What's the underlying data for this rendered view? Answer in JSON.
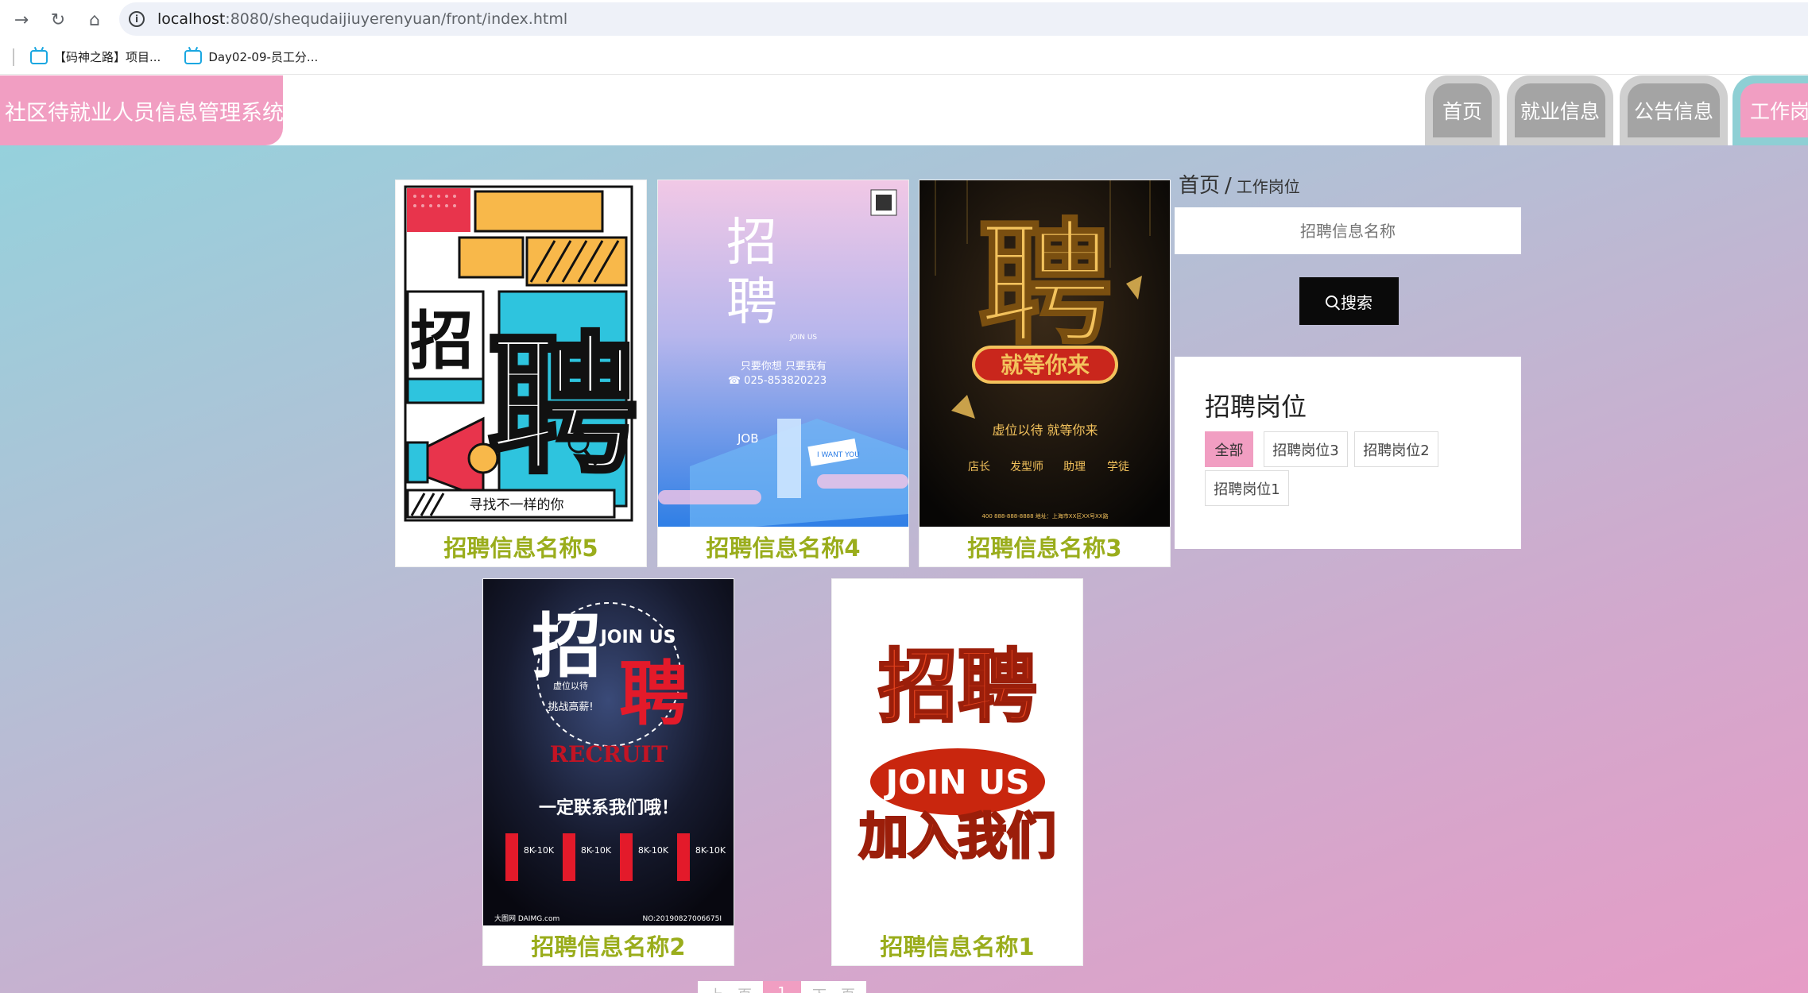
{
  "browser": {
    "url_host": "localhost",
    "url_rest": ":8080/shequdaijiuyerenyuan/front/index.html",
    "bookmarks": [
      "【码神之路】项目...",
      "Day02-09-员工分..."
    ]
  },
  "site": {
    "title": "社区待就业人员信息管理系统",
    "nav": [
      "首页",
      "就业信息",
      "公告信息",
      "工作岗位"
    ]
  },
  "breadcrumb": {
    "home": "首页",
    "sep": "/",
    "current": "工作岗位"
  },
  "search": {
    "placeholder": "招聘信息名称",
    "button": "搜索"
  },
  "categories": {
    "title": "招聘岗位",
    "tags": [
      "全部",
      "招聘岗位3",
      "招聘岗位2",
      "招聘岗位1"
    ],
    "selected": "全部"
  },
  "jobs": [
    {
      "name": "招聘信息名称5",
      "poster": {
        "big1": "招",
        "big2": "聘",
        "slogan": "寻找不一样的你"
      }
    },
    {
      "name": "招聘信息名称4",
      "poster": {
        "c1": "招",
        "c2": "聘",
        "join": "JOIN US",
        "line1": "只要你想 只要我有",
        "phone": "☎ 025-853820223",
        "job": "JOB",
        "want": "I WANT YOU"
      }
    },
    {
      "name": "招聘信息名称3",
      "poster": {
        "big": "聘",
        "banner": "就等你来",
        "sub": "虚位以待 就等你来",
        "roles": [
          "店长",
          "发型师",
          "助理",
          "学徒"
        ],
        "footer": "400 888-888-8888 地址：上海市XX区XX号XX路"
      }
    },
    {
      "name": "招聘信息名称2",
      "poster": {
        "c1": "招",
        "c2": "聘",
        "join": "JOIN US",
        "circle1": "虚位以待",
        "circle2": "挑战高薪!",
        "recruit": "RECRUIT",
        "contact": "一定联系我们哦！",
        "salary": "8K-10K",
        "brand": "大图网 DAIMG.com",
        "no": "NO:20190827006675I"
      }
    },
    {
      "name": "招聘信息名称1",
      "poster": {
        "c1": "招聘",
        "join": "JOIN US",
        "bottom": "加入我们"
      }
    }
  ],
  "pager": {
    "prev": "上一页",
    "current": "1",
    "next": "下一页"
  },
  "colors": {
    "accent_pink": "#f19ec2",
    "caption_green": "#9aad1c"
  }
}
